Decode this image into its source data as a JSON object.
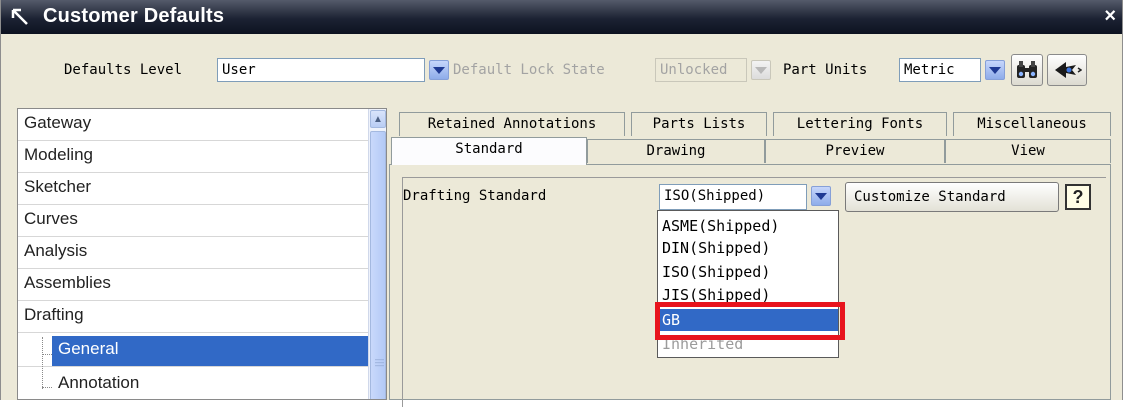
{
  "window": {
    "title": "Customer Defaults",
    "close_symbol": "×"
  },
  "options": {
    "defaults_level_label": "Defaults Level",
    "defaults_level_value": "User",
    "lock_state_label": "Default Lock State",
    "lock_state_value": "Unlocked",
    "part_units_label": "Part Units",
    "part_units_value": "Metric"
  },
  "tree": {
    "items": [
      {
        "label": "Gateway"
      },
      {
        "label": "Modeling"
      },
      {
        "label": "Sketcher"
      },
      {
        "label": "Curves"
      },
      {
        "label": "Analysis"
      },
      {
        "label": "Assemblies"
      },
      {
        "label": "Drafting"
      },
      {
        "label": "General"
      },
      {
        "label": "Annotation"
      }
    ],
    "selected": "General"
  },
  "tabs": {
    "row1": [
      "Retained Annotations",
      "Parts Lists",
      "Lettering Fonts",
      "Miscellaneous"
    ],
    "row2": [
      "Standard",
      "Drawing",
      "Preview",
      "View"
    ],
    "active": "Standard"
  },
  "drafting": {
    "label": "Drafting Standard",
    "value": "ISO(Shipped)",
    "customize_label": "Customize Standard",
    "help_symbol": "?",
    "options": [
      "ASME(Shipped)",
      "DIN(Shipped)",
      "ISO(Shipped)",
      "JIS(Shipped)",
      "GB",
      "Inherited"
    ],
    "highlighted": "GB"
  },
  "icons": [
    "app-arrow-icon",
    "close-icon",
    "chevron-down-icon",
    "binoculars-icon",
    "arrow-wizard-icon",
    "scroll-up-icon",
    "help-icon"
  ],
  "colors": {
    "selection": "#3169c6",
    "highlight_box": "#e8141d",
    "titlebar": "#1c2233"
  }
}
